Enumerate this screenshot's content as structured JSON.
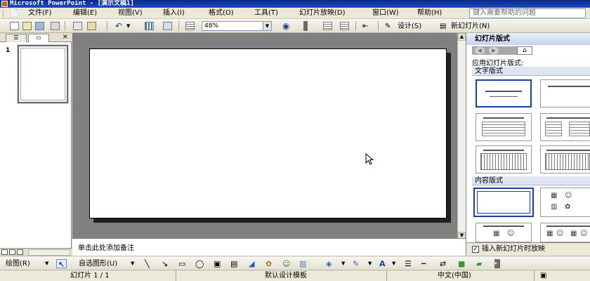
{
  "window": {
    "title": "Microsoft PowerPoint - [演示文稿1]"
  },
  "menu": {
    "items": [
      "文件(F)",
      "编辑(E)",
      "视图(V)",
      "插入(I)",
      "格式(O)",
      "工具(T)",
      "幻灯片放映(D)",
      "窗口(W)",
      "帮助(H)"
    ],
    "help_placeholder": "键入需要帮助的问题"
  },
  "toolbar": {
    "zoom": "48%",
    "design_label": "设计(S)",
    "new_slide_label": "新幻灯片(N)"
  },
  "slides_pane": {
    "tab_outline": "☰",
    "tab_slides": "▭",
    "close": "×",
    "slide_number": "1"
  },
  "notes": {
    "placeholder": "单击此处添加备注"
  },
  "task_pane": {
    "title": "幻灯片版式",
    "apply_label": "应用幻灯片版式:",
    "section_text": "文字版式",
    "section_content": "内容版式",
    "insert_on_new": "插入新幻灯片时放映",
    "home_icon": "⌂"
  },
  "drawing": {
    "draw_label": "绘图(R)",
    "autoshape_label": "自选图形(U)"
  },
  "status": {
    "slide": "幻灯片 1 / 1",
    "template": "默认设计模板",
    "language": "中文(中国)"
  }
}
